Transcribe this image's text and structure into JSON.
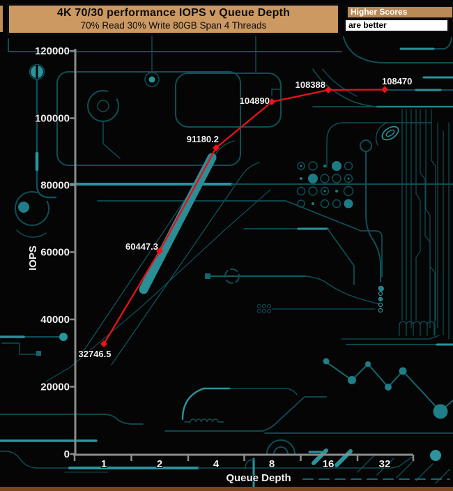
{
  "header": {
    "title": "4K 70/30 performance IOPS v Queue Depth",
    "subtitle": "70% Read 30% Write 80GB Span 4 Threads"
  },
  "legend": {
    "line1": "Higher Scores",
    "line2": "are better"
  },
  "colors": {
    "accent_red": "#e8111a",
    "trace_dark": "#0f4f58",
    "trace_bright": "#2b939b",
    "header_tan": "#cc9963",
    "axis_gray": "#8c8c8c",
    "bottom_strip_brown": "#7c451b"
  },
  "chart_data": {
    "type": "line",
    "title": "4K 70/30 performance IOPS v Queue Depth",
    "subtitle": "70% Read 30% Write 80GB Span 4 Threads",
    "xlabel": "Queue Depth",
    "ylabel": "IOPS",
    "categories": [
      "1",
      "2",
      "4",
      "8",
      "16",
      "32"
    ],
    "series": [
      {
        "name": "IOPS",
        "values": [
          32746.5,
          60447.3,
          91180.2,
          104890,
          108388,
          108470
        ]
      }
    ],
    "point_labels": [
      "32746.5",
      "60447.3",
      "91180.2",
      "104890",
      "108388",
      "108470"
    ],
    "ylim": [
      0,
      120000
    ],
    "yticks": [
      "120000",
      "100000",
      "80000",
      "60000",
      "40000",
      "20000",
      "0"
    ],
    "grid": false,
    "legend_position": "top-right",
    "line_color": "#e8111a"
  }
}
